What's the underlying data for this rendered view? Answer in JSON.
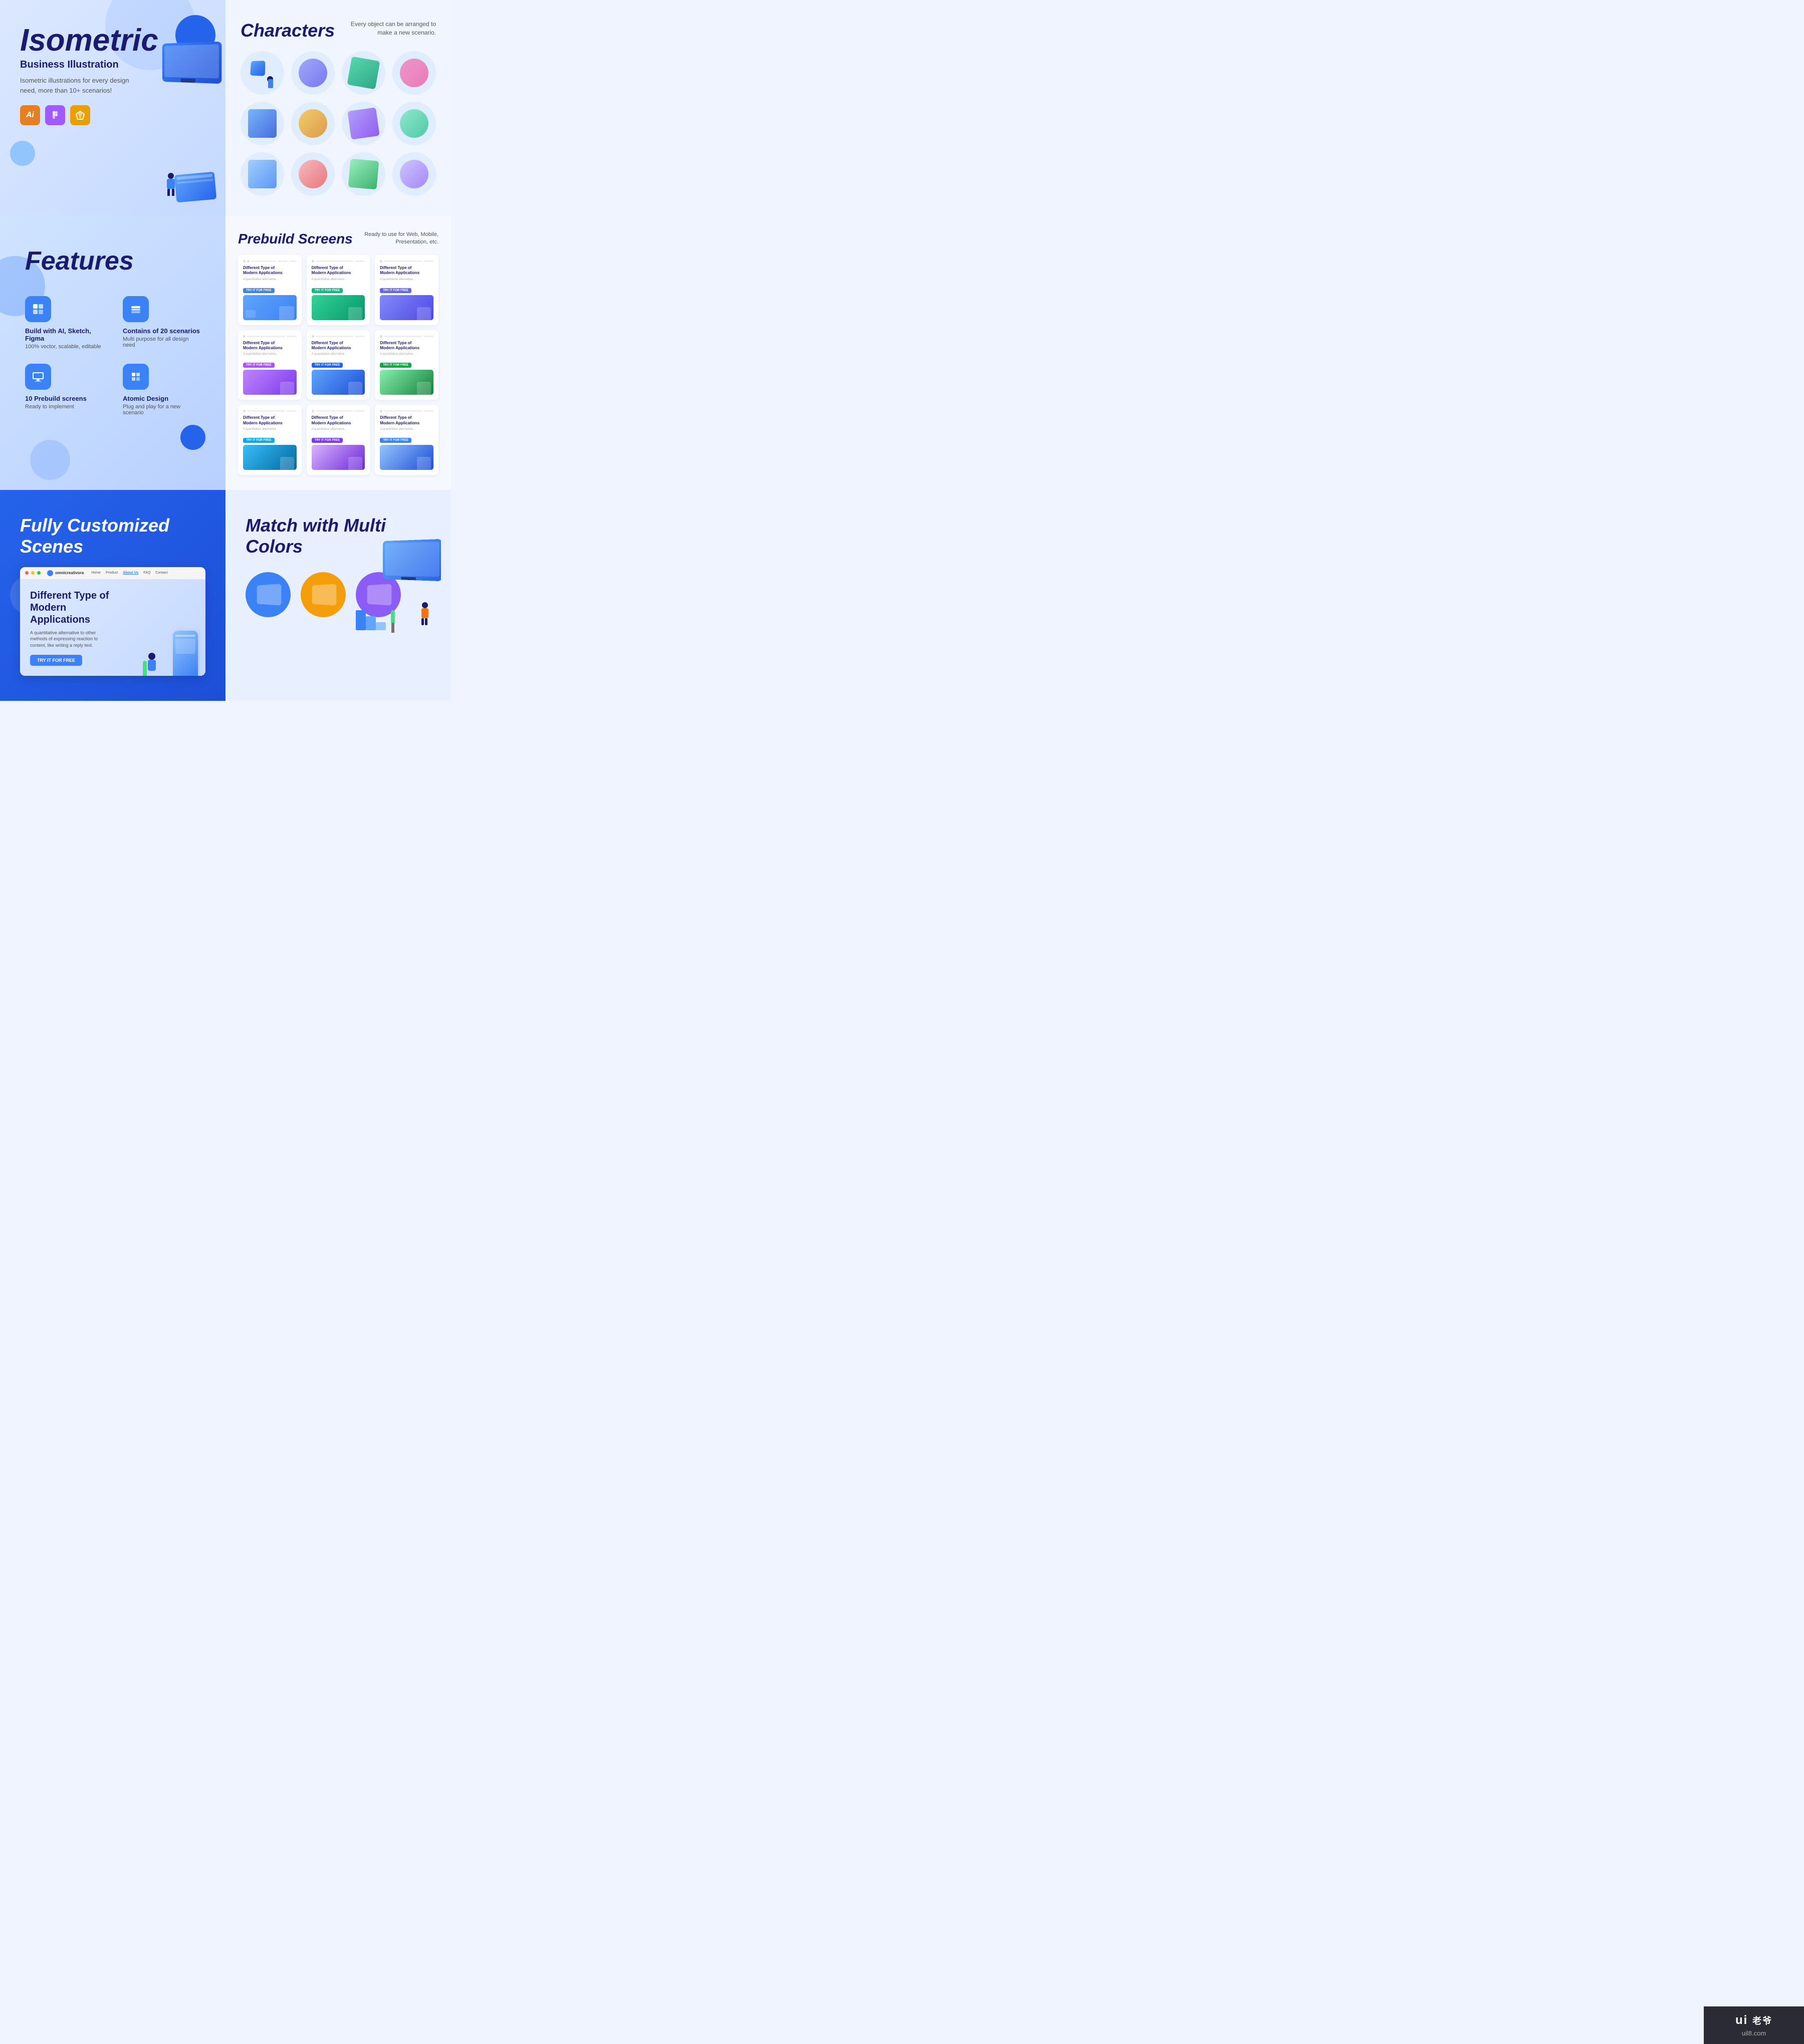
{
  "hero": {
    "title": "Isometric",
    "subtitle": "Business Illustration",
    "description": "Isometric illustrations for every design need, more than 10+ scenarios!",
    "badges": [
      "Ai",
      "F",
      "S"
    ],
    "badge_colors": [
      "#e67e22",
      "#a259ff",
      "#e67e22"
    ]
  },
  "characters": {
    "title": "Characters",
    "description": "Every object can be arranged to make a new scenario."
  },
  "features": {
    "title": "Features",
    "items": [
      {
        "icon": "⊞",
        "name": "Build with AI, Sketch, Figma",
        "sub": "100% vector, scalable, editable"
      },
      {
        "icon": "⊕",
        "name": "Contains of 20 scenarios",
        "sub": "Multi purpose for all design need"
      },
      {
        "icon": "⊡",
        "name": "10 Prebuild screens",
        "sub": "Ready to implement"
      },
      {
        "icon": "⊞",
        "name": "Atomic Design",
        "sub": "Plug and play for a new scenario"
      }
    ]
  },
  "prebuild": {
    "title": "Prebuild Screens",
    "description": "Ready to use for Web, Mobile, Presentation, etc.",
    "cards": [
      {
        "title": "Different Type of Modern Applications",
        "text": "A quantitative alternative...",
        "btn_color": "blue",
        "gradient": [
          "#60a5fa",
          "#3b82f6"
        ]
      },
      {
        "title": "Different Type of Modern Applications",
        "text": "A quantitative alternative...",
        "btn_color": "green",
        "gradient": [
          "#34d399",
          "#10b981"
        ]
      },
      {
        "title": "Different Type of Modern Applications",
        "text": "A quantitative alternative...",
        "btn_color": "blue",
        "gradient": [
          "#818cf8",
          "#6366f1"
        ]
      },
      {
        "title": "Different Type of Modern Applications",
        "text": "A quantitative alternative...",
        "btn_color": "purple",
        "gradient": [
          "#c084fc",
          "#a855f7"
        ]
      },
      {
        "title": "Different Type of Modern Applications",
        "text": "A quantitative alternative...",
        "btn_color": "blue",
        "gradient": [
          "#60a5fa",
          "#2563eb"
        ]
      },
      {
        "title": "Different Type of Modern Applications",
        "text": "A quantitative alternative...",
        "btn_color": "green",
        "gradient": [
          "#86efac",
          "#22c55e"
        ]
      },
      {
        "title": "Different Type of Modern Applications",
        "text": "A quantitative alternative...",
        "btn_color": "blue",
        "gradient": [
          "#38bdf8",
          "#0ea5e9"
        ]
      },
      {
        "title": "Different Type of Modern Applications",
        "text": "A quantitative alternative...",
        "btn_color": "purple",
        "gradient": [
          "#d8b4fe",
          "#8b5cf6"
        ]
      },
      {
        "title": "Different Type of Modern Applications",
        "text": "A quantitative alternative...",
        "btn_color": "blue",
        "gradient": [
          "#93c5fd",
          "#3b82f6"
        ]
      }
    ]
  },
  "custom": {
    "title": "Fully Customized Scenes",
    "browser": {
      "nav": [
        "Home",
        "Product",
        "About Us",
        "FAQ",
        "Contact"
      ],
      "active_nav": "About Us",
      "logo": "omnicreativora",
      "hero_title": "Different Type of Modern Applications",
      "hero_desc": "A quantitative alternative to other methods of expressing reaction to content, like writing a reply text.",
      "cta": "TRY IT FOR FREE"
    }
  },
  "match": {
    "title": "Match with Multi Colors",
    "colors": [
      "#3b82f6",
      "#f59e0b",
      "#10b981",
      "#8b5cf6",
      "#ef4444"
    ]
  },
  "watermark": {
    "line1": "ui 老爷",
    "line2": "uil8.com"
  }
}
